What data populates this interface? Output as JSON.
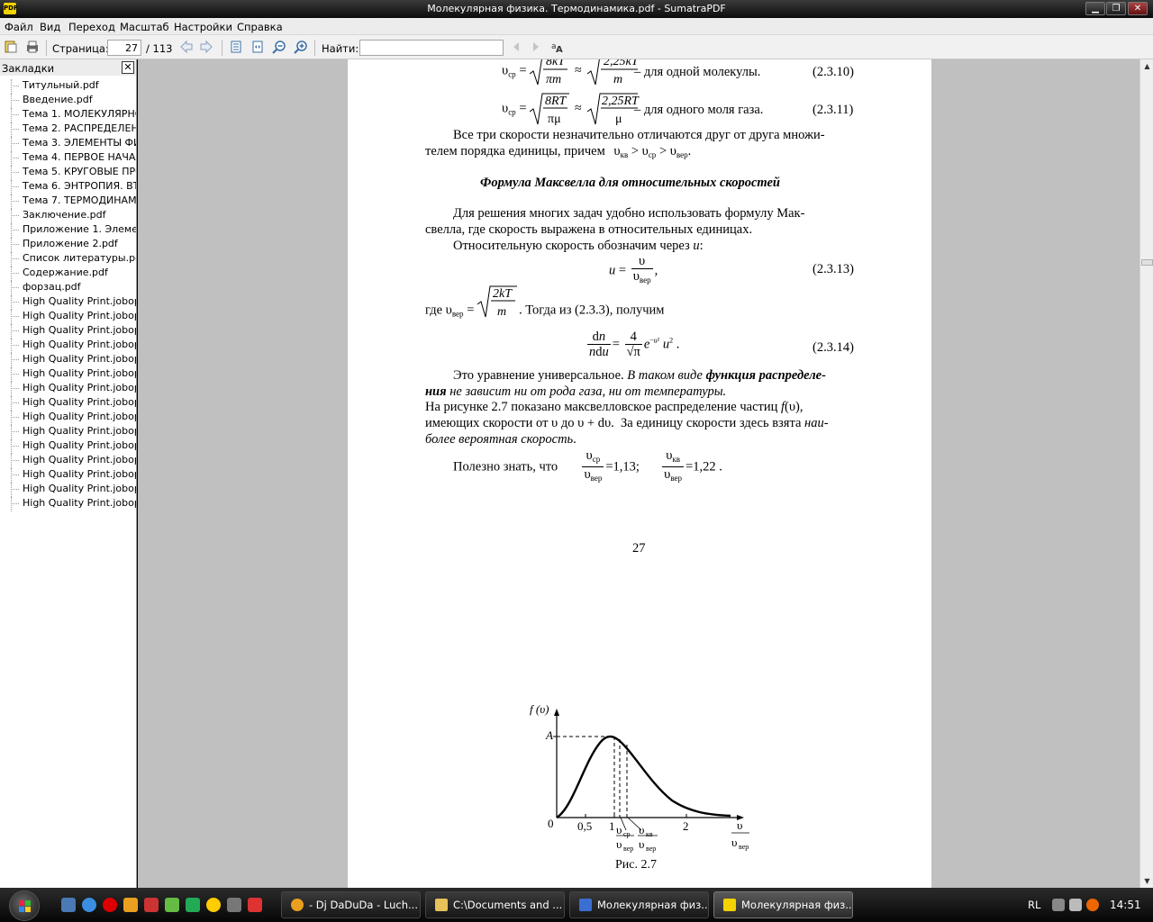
{
  "window": {
    "title": "Молекулярная физика. Термодинамика.pdf - SumatraPDF"
  },
  "menu": [
    "Файл",
    "Вид",
    "Переход",
    "Масштаб",
    "Настройки",
    "Справка"
  ],
  "toolbar": {
    "page_label": "Страница:",
    "page_value": "27",
    "page_total": "/ 113",
    "find_label": "Найти:",
    "find_value": ""
  },
  "sidebar": {
    "title": "Закладки",
    "items": [
      "Титульный.pdf",
      "Введение.pdf",
      "Тема 1. МОЛЕКУЛЯРНО-",
      "Тема 2. РАСПРЕДЕЛЕНИ",
      "Тема 3. ЭЛЕМЕНТЫ ФИЗИ",
      "Тема 4. ПЕРВОЕ НАЧАЛО",
      "Тема 5.  КРУГОВЫЕ ПРО",
      "Тема 6. ЭНТРОПИЯ. ВТО",
      "Тема 7. ТЕРМОДИНАМИ",
      "Заключение.pdf",
      "Приложение 1. Элемен",
      "Приложение 2.pdf",
      "Список литературы.pdf",
      "Содержание.pdf",
      "форзац.pdf",
      "High Quality Print.jobop",
      "High Quality Print.jobop",
      "High Quality Print.jobop",
      "High Quality Print.jobop",
      "High Quality Print.jobop",
      "High Quality Print.jobop",
      "High Quality Print.jobop",
      "High Quality Print.jobop",
      "High Quality Print.jobop",
      "High Quality Print.jobop",
      "High Quality Print.jobop",
      "High Quality Print.jobop",
      "High Quality Print.jobop",
      "High Quality Print.jobop",
      "High Quality Print.jobop"
    ]
  },
  "doc": {
    "eq10_text": "– для одной молекулы.",
    "eq10_num": "(2.3.10)",
    "eq11_text": "– для одного моля газа.",
    "eq11_num": "(2.3.11)",
    "para1_l1": "Все три скорости незначительно отличаются друг от друга множи-",
    "para1_l2": "телем порядка единицы, причем",
    "heading": "Формула Максвелла для относительных скоростей",
    "para2_l1": "Для решения многих задач удобно использовать формулу Мак-",
    "para2_l2": "свелла, где скорость выражена в относительных единицах.",
    "para3": "Относительную скорость обозначим через",
    "eq13_num": "(2.3.13)",
    "where_prefix": "где",
    "where_suffix": ". Тогда из (2.3.3), получим",
    "eq14_num": "(2.3.14)",
    "para4_a": "Это уравнение универсальное.",
    "para4_b": "В таком виде",
    "para4_c": "функция распределе-",
    "para4_d": "ния",
    "para4_e": "не зависит ни от рода газа, ни от температуры.",
    "para5_l1": "На рисунке 2.7 показано максвелловское распределение частиц",
    "para5_l2": "имеющих скорости от υ до",
    "para5_l2b": "За единицу скорости здесь взята",
    "para5_l2c": "наи-",
    "para5_l3": "более вероятная скорость",
    "para6": "Полезно знать, что",
    "ratio1": "=1,13;",
    "ratio2": "=1,22 .",
    "page_number": "27",
    "figure_caption": "Рис. 2.7",
    "fig_y_label": "f (υ)",
    "fig_A": "A",
    "fig_ticks": [
      "0",
      "0,5",
      "1",
      "2"
    ]
  },
  "taskbar": {
    "tasks": [
      "- Dj DaDuDa - Luch...",
      "C:\\Documents and ...",
      "Молекулярная физ...",
      "Молекулярная физ..."
    ],
    "lang": "RL",
    "clock": "14:51"
  }
}
